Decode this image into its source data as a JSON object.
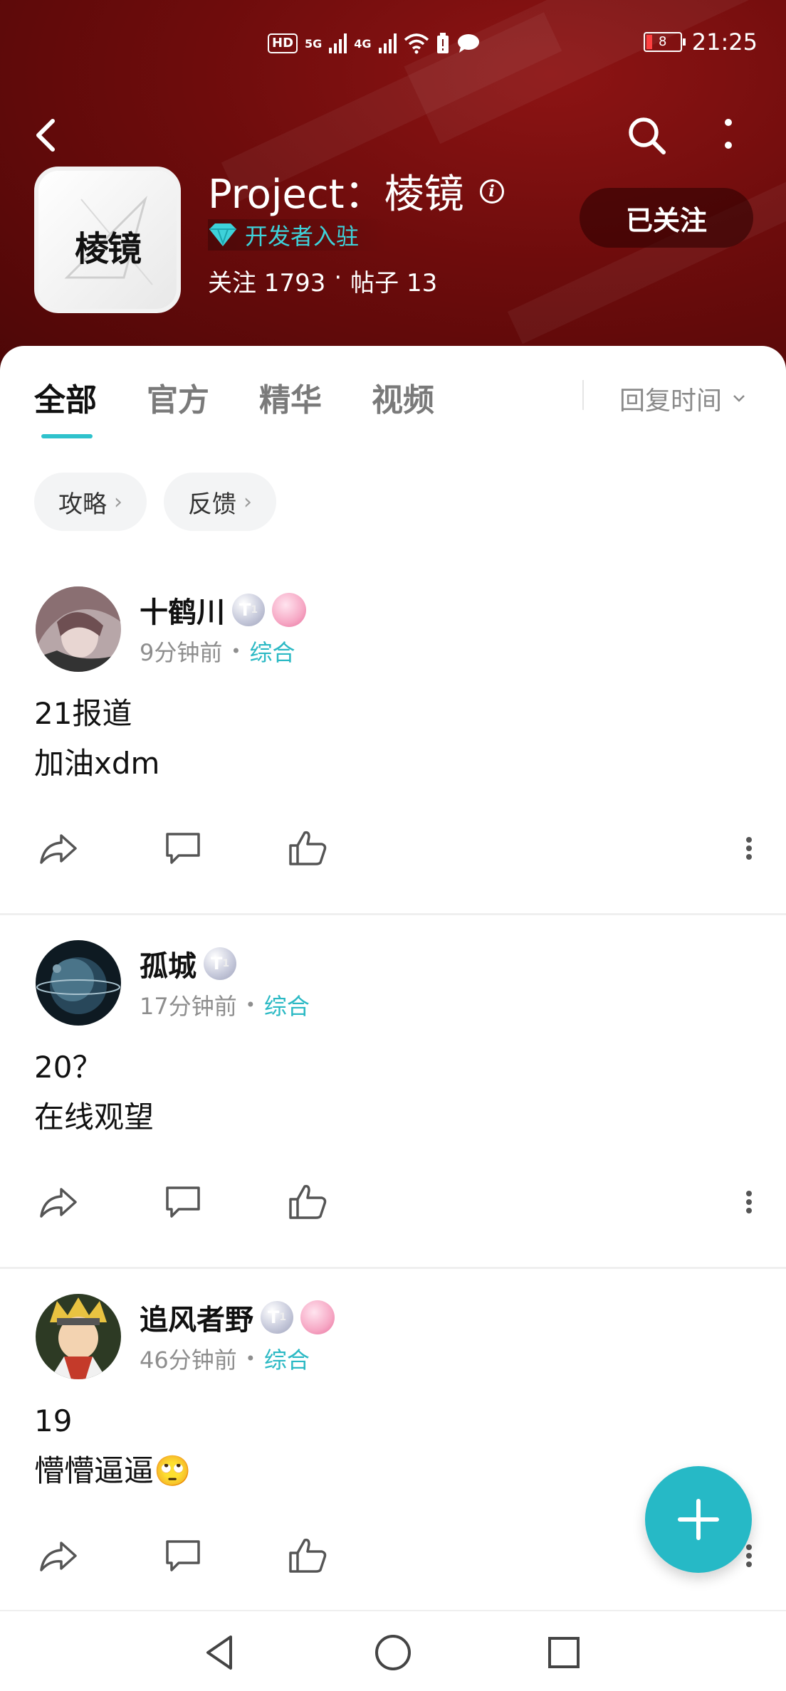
{
  "status_bar": {
    "hd": "HD",
    "sim1": "5G",
    "sim2": "4G",
    "battery": "8",
    "time": "21:25"
  },
  "header": {
    "logo_text": "棱镜",
    "title": "Project：棱镜",
    "dev_badge": "开发者入驻",
    "stats": {
      "followers": "关注 1793",
      "sep": "·",
      "posts": "帖子 13"
    },
    "follow_button": "已关注"
  },
  "tabs": [
    {
      "label": "全部",
      "active": true
    },
    {
      "label": "官方",
      "active": false
    },
    {
      "label": "精华",
      "active": false
    },
    {
      "label": "视频",
      "active": false
    }
  ],
  "sort": {
    "label": "回复时间",
    "icon": "chevron-down-icon"
  },
  "chips": [
    {
      "label": "攻略"
    },
    {
      "label": "反馈"
    }
  ],
  "posts": [
    {
      "username": "十鹤川",
      "level": "T",
      "level_sub": "1",
      "has_girl_badge": true,
      "time": "9分钟前",
      "category": "综合",
      "lines": [
        "21报道",
        "加油xdm"
      ]
    },
    {
      "username": "孤城",
      "level": "T",
      "level_sub": "1",
      "has_girl_badge": false,
      "time": "17分钟前",
      "category": "综合",
      "lines": [
        "20？",
        "在线观望"
      ]
    },
    {
      "username": "追风者野",
      "level": "T",
      "level_sub": "1",
      "has_girl_badge": true,
      "time": "46分钟前",
      "category": "综合",
      "lines": [
        "19",
        "懵懵逼逼🙄"
      ]
    }
  ],
  "colors": {
    "accent": "#2bb9c4",
    "header_bg": "#6e0c0c"
  }
}
